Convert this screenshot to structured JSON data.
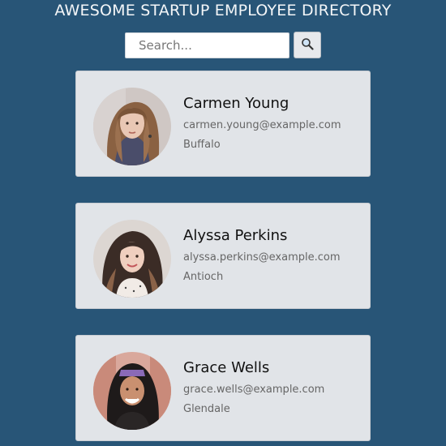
{
  "header": {
    "title": "AWESOME STARTUP EMPLOYEE DIRECTORY"
  },
  "search": {
    "placeholder": "Search...",
    "value": "",
    "button_icon": "search-icon"
  },
  "employees": [
    {
      "name": "Carmen Young",
      "email": "carmen.young@example.com",
      "city": "Buffalo"
    },
    {
      "name": "Alyssa Perkins",
      "email": "alyssa.perkins@example.com",
      "city": "Antioch"
    },
    {
      "name": "Grace Wells",
      "email": "grace.wells@example.com",
      "city": "Glendale"
    }
  ],
  "colors": {
    "background": "#285577",
    "card": "#e1e4e8",
    "title": "#f4f6f8"
  }
}
